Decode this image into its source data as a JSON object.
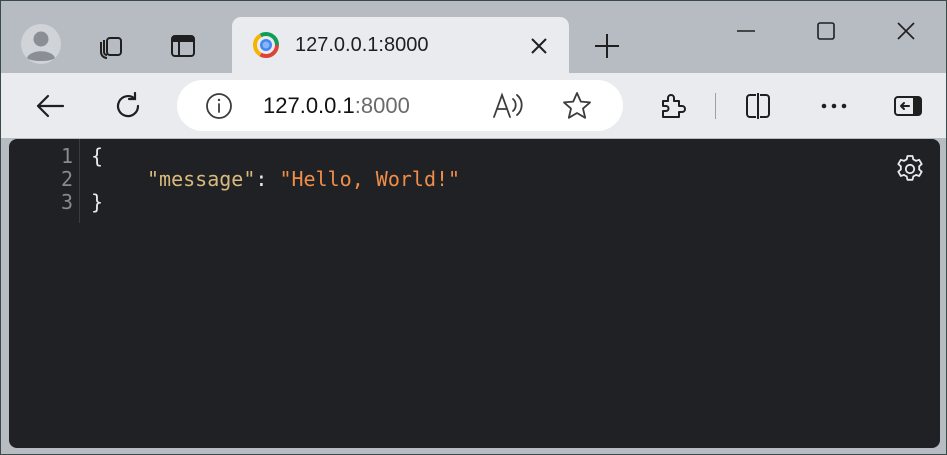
{
  "tab": {
    "title": "127.0.0.1:8000"
  },
  "address_bar": {
    "host": "127.0.0.1",
    "port": ":8000"
  },
  "viewer": {
    "lines": [
      {
        "number": "1",
        "open": "{"
      },
      {
        "number": "2",
        "key": "\"message\"",
        "colon": ": ",
        "value": "\"Hello, World!\""
      },
      {
        "number": "3",
        "close": "}"
      }
    ]
  },
  "colors": {
    "json_key": "#d7ba7d",
    "json_string": "#f08d49",
    "viewer_background": "#202124"
  },
  "icons": {
    "profile": "profile-icon",
    "workspaces": "workspaces-icon",
    "vertical_tabs": "vertical-tabs-icon",
    "close_tab": "close-icon",
    "new_tab": "plus-icon",
    "back": "back-arrow-icon",
    "refresh": "refresh-icon",
    "site_info": "info-icon",
    "read_aloud": "read-aloud-icon",
    "favorite": "star-icon",
    "extensions": "puzzle-icon",
    "split_screen": "split-screen-icon",
    "more": "more-dots-icon",
    "sidebar": "sidebar-icon",
    "settings": "gear-icon"
  }
}
